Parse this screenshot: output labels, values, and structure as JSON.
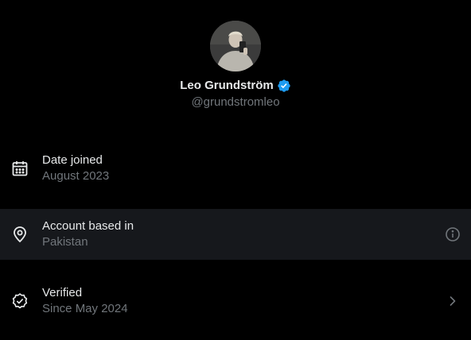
{
  "profile": {
    "name": "Leo Grundström",
    "handle": "@grundstromleo",
    "verified": true
  },
  "rows": [
    {
      "label": "Date joined",
      "value": "August 2023",
      "icon": "calendar-icon"
    },
    {
      "label": "Account based in",
      "value": "Pakistan",
      "icon": "location-pin-icon",
      "action_icon": "info-icon"
    },
    {
      "label": "Verified",
      "value": "Since May 2024",
      "icon": "verified-check-icon",
      "action_icon": "chevron-right-icon"
    }
  ],
  "colors": {
    "background": "#000000",
    "highlight_row": "#16181c",
    "primary_text": "#e7e9ea",
    "secondary_text": "#71767b",
    "verified_blue": "#1d9bf0"
  }
}
